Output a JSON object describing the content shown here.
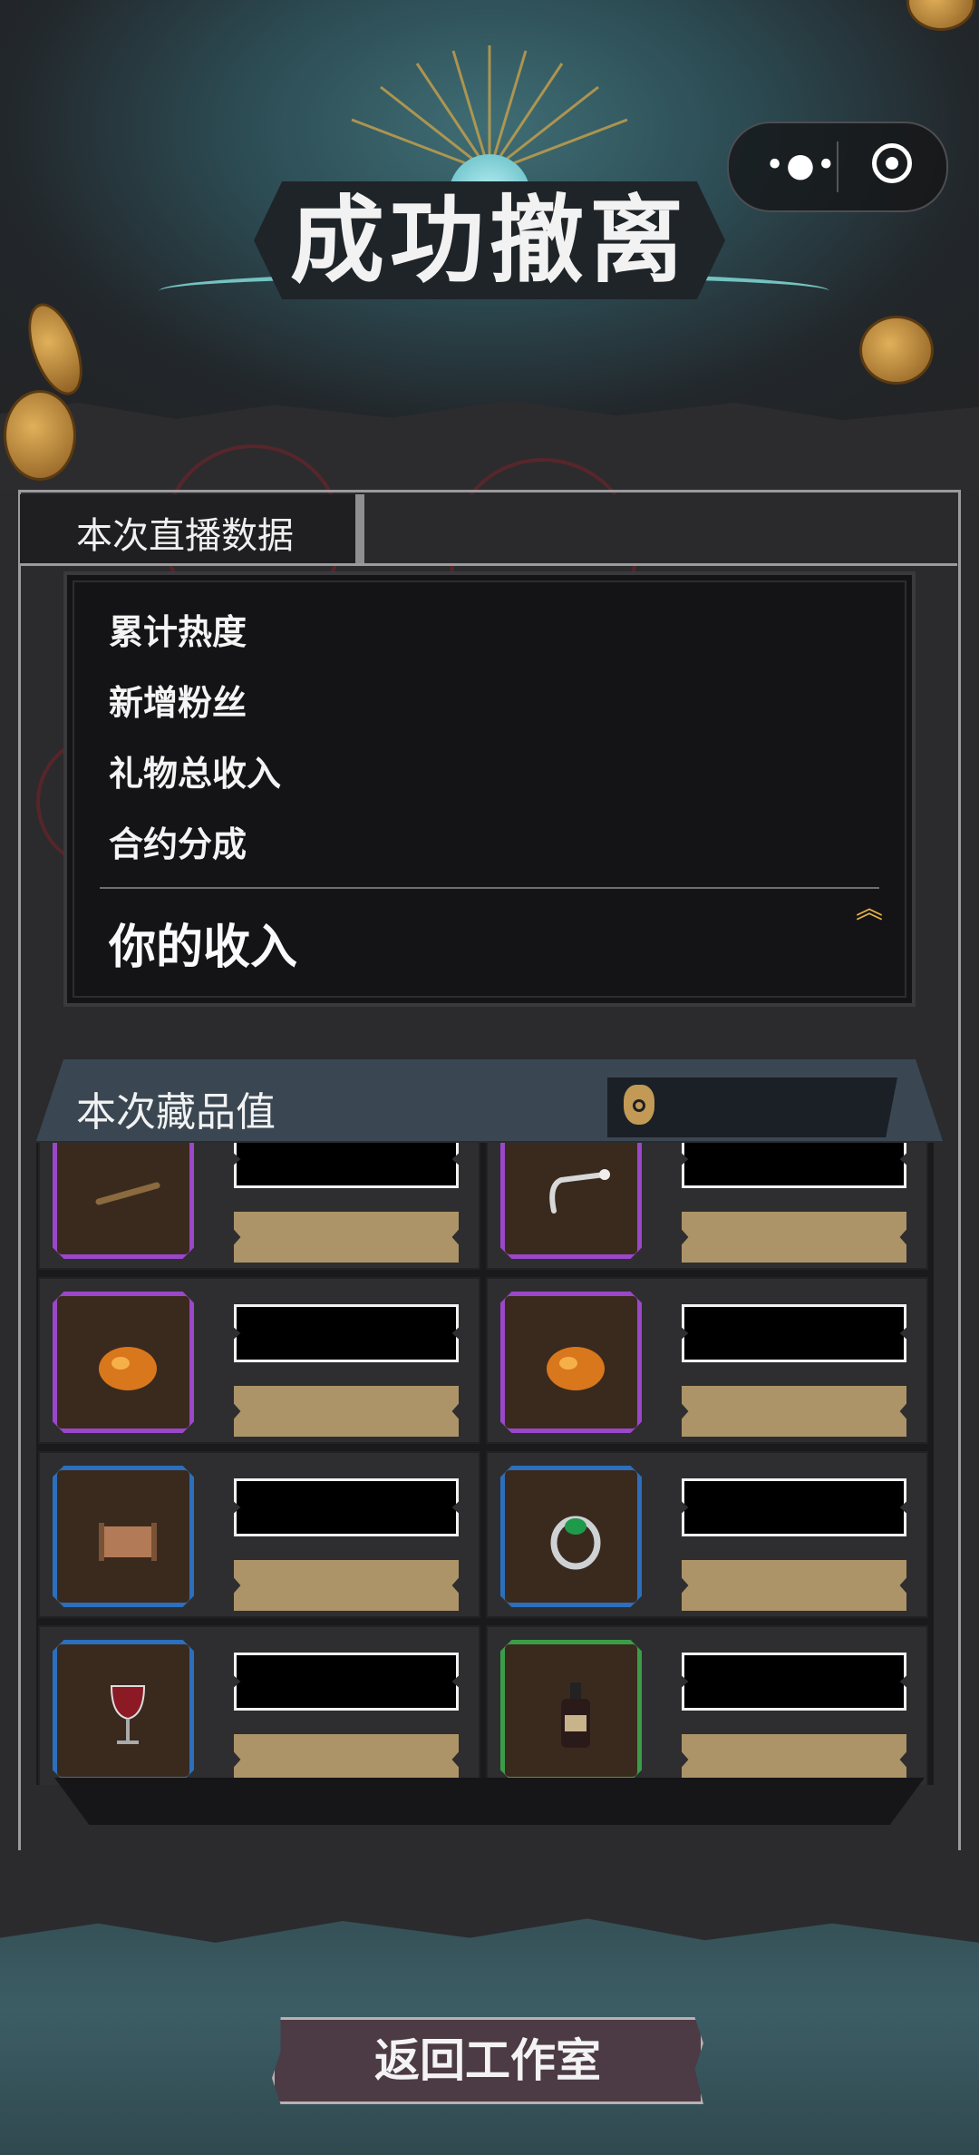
{
  "header": {
    "title": "成功撤离"
  },
  "capsule": {
    "menu_icon": "more-dots-icon",
    "close_icon": "target-icon"
  },
  "live_stats": {
    "tab_label": "本次直播数据",
    "rows": [
      {
        "label": "累计热度"
      },
      {
        "label": "新增粉丝"
      },
      {
        "label": "礼物总收入"
      },
      {
        "label": "合约分成"
      }
    ],
    "income_label": "你的收入",
    "expand_icon": "double-chevron-up-icon"
  },
  "collection": {
    "title": "本次藏品值",
    "value_icon": "money-bag-icon",
    "items": [
      {
        "icon": "flute-icon",
        "rarity_color": "#9a47c9"
      },
      {
        "icon": "pipe-icon",
        "rarity_color": "#9a47c9"
      },
      {
        "icon": "amber-icon",
        "rarity_color": "#9a47c9"
      },
      {
        "icon": "amber-icon",
        "rarity_color": "#9a47c9"
      },
      {
        "icon": "scroll-icon",
        "rarity_color": "#2b6fbd"
      },
      {
        "icon": "jade-ring-icon",
        "rarity_color": "#2b6fbd"
      },
      {
        "icon": "wine-glass-icon",
        "rarity_color": "#2b6fbd"
      },
      {
        "icon": "wine-bottle-icon",
        "rarity_color": "#3a9d48"
      }
    ]
  },
  "footer": {
    "return_label": "返回工作室"
  },
  "colors": {
    "accent_gold": "#e7b24a",
    "value_bar": "#ac9468",
    "button": "#4c3a44"
  }
}
